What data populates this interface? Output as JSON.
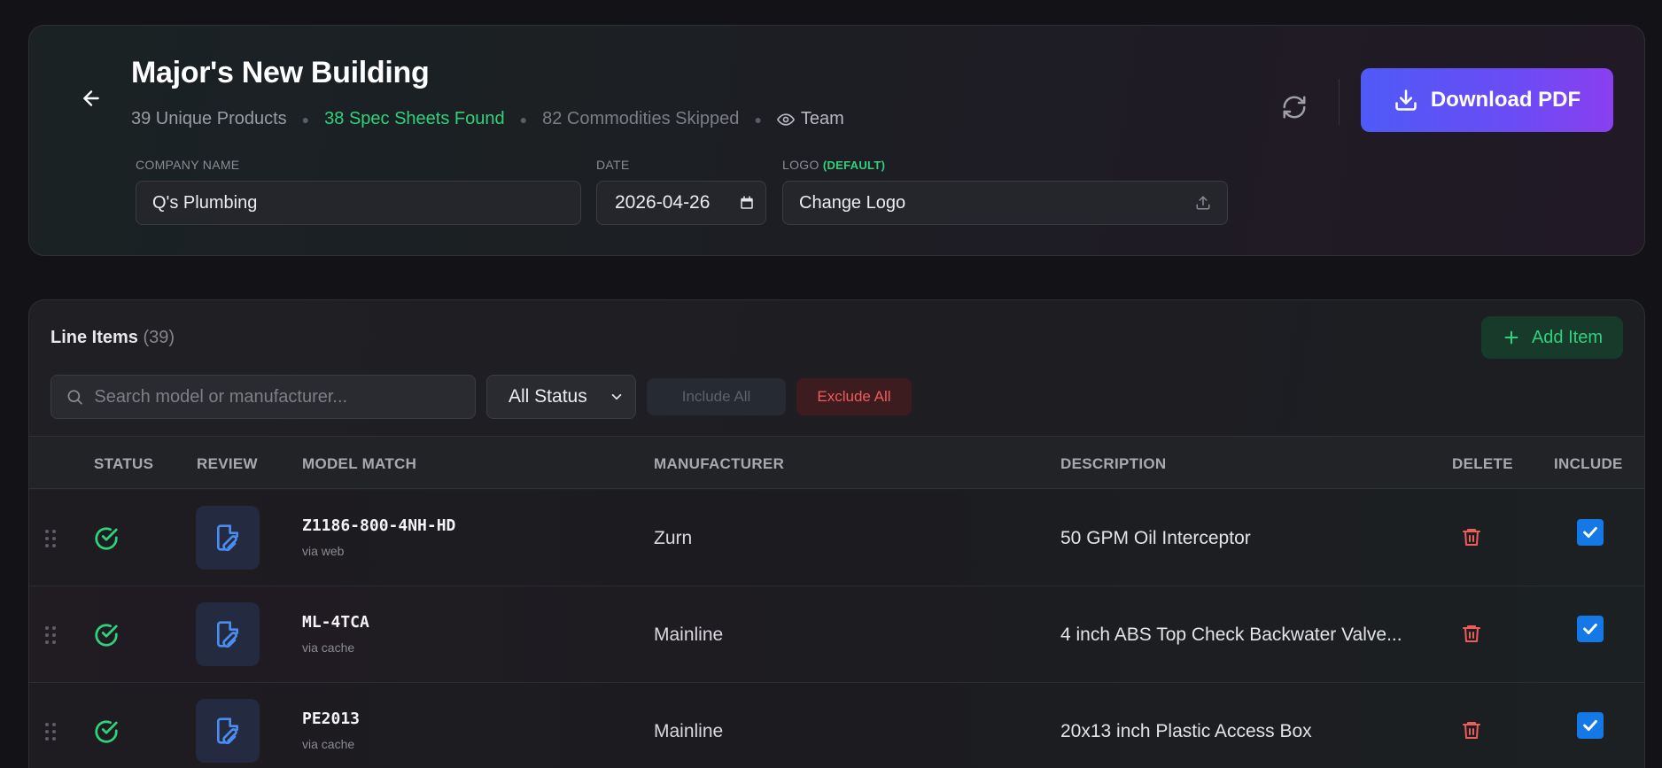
{
  "project": {
    "title": "Major's New Building",
    "unique_products": "39 Unique Products",
    "spec_sheets": "38 Spec Sheets Found",
    "skipped": "82 Commodities Skipped",
    "visibility": "Team"
  },
  "actions": {
    "download_label": "Download PDF"
  },
  "form": {
    "company_label": "COMPANY NAME",
    "company_value": "Q's Plumbing",
    "date_label": "DATE",
    "date_value": "2026-04-26",
    "logo_label": "LOGO",
    "logo_default": "(DEFAULT)",
    "logo_button": "Change Logo"
  },
  "line_items": {
    "title": "Line Items",
    "count": "(39)",
    "add_label": "Add Item",
    "search_placeholder": "Search model or manufacturer...",
    "status_filter": "All Status",
    "include_all": "Include All",
    "exclude_all": "Exclude All",
    "columns": [
      "STATUS",
      "REVIEW",
      "MODEL MATCH",
      "MANUFACTURER",
      "DESCRIPTION",
      "DELETE",
      "INCLUDE"
    ],
    "rows": [
      {
        "model": "Z1186-800-4NH-HD",
        "source": "via web",
        "manufacturer": "Zurn",
        "description": "50 GPM Oil Interceptor",
        "included": true
      },
      {
        "model": "ML-4TCA",
        "source": "via cache",
        "manufacturer": "Mainline",
        "description": "4 inch ABS Top Check Backwater Valve...",
        "included": true
      },
      {
        "model": "PE2013",
        "source": "via cache",
        "manufacturer": "Mainline",
        "description": "20x13 inch Plastic Access Box",
        "included": true
      }
    ]
  },
  "colors": {
    "accent_green": "#2fd27b",
    "danger_red": "#f05b5b",
    "primary_gradient_start": "#4f5af6",
    "primary_gradient_end": "#8a3ff0",
    "checkbox_blue": "#1478e6"
  }
}
